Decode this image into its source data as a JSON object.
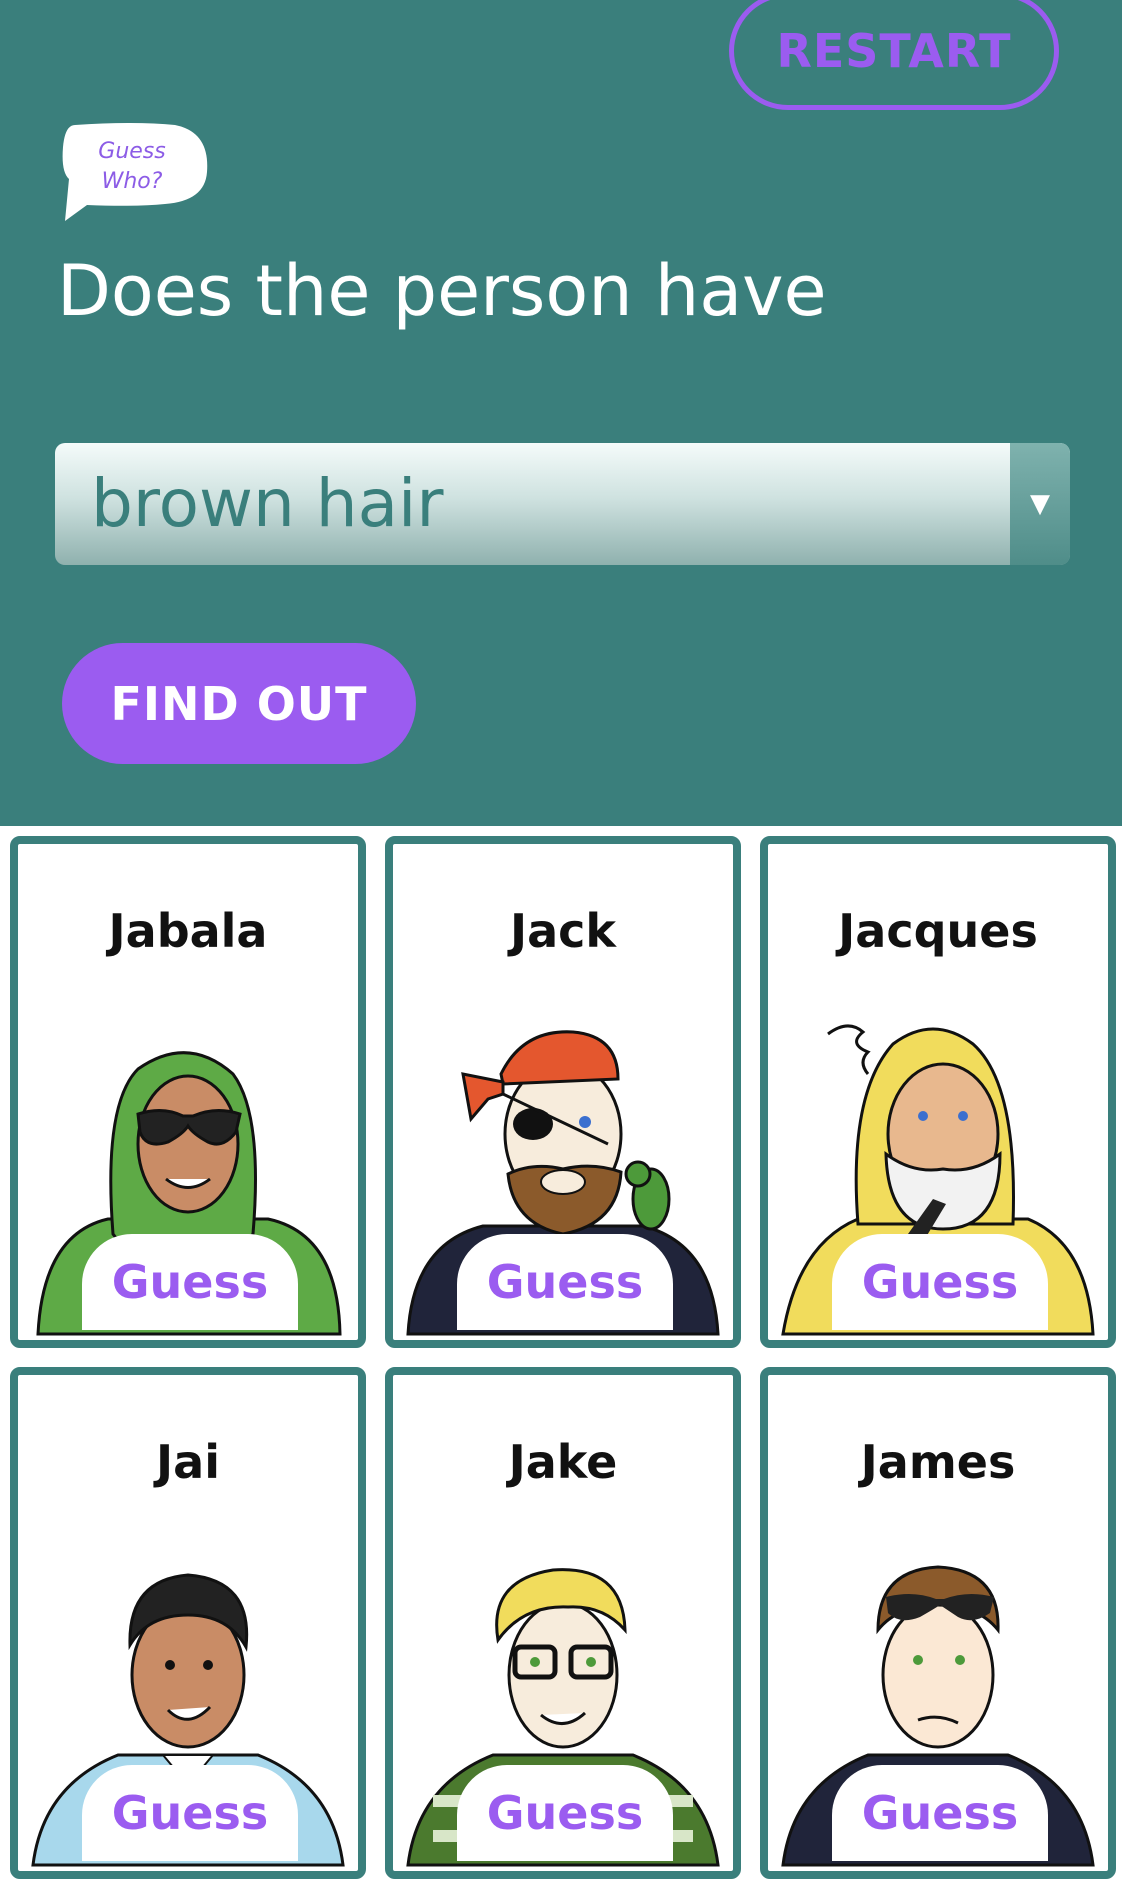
{
  "header": {
    "restart_label": "RESTART",
    "logo_line1": "Guess",
    "logo_line2": "Who?",
    "question": "Does the person have",
    "selected_feature": "brown hair",
    "find_out_label": "FIND OUT"
  },
  "colors": {
    "header_bg": "#3a7f7c",
    "accent": "#9b5cf0",
    "card_border": "#3a7f7c"
  },
  "cards": [
    {
      "name": "Jabala",
      "guess_label": "Guess"
    },
    {
      "name": "Jack",
      "guess_label": "Guess"
    },
    {
      "name": "Jacques",
      "guess_label": "Guess"
    },
    {
      "name": "Jai",
      "guess_label": "Guess"
    },
    {
      "name": "Jake",
      "guess_label": "Guess"
    },
    {
      "name": "James",
      "guess_label": "Guess"
    }
  ]
}
